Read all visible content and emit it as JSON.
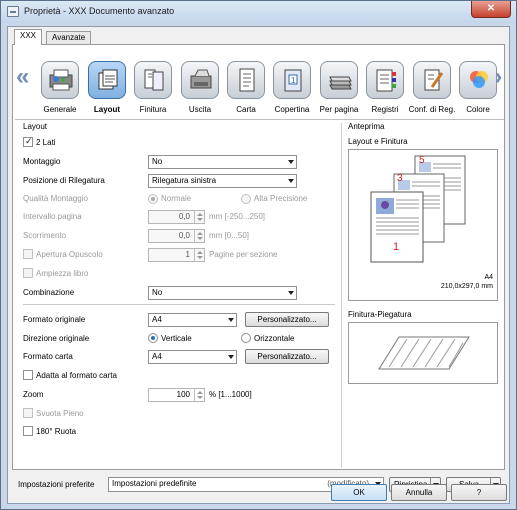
{
  "window": {
    "title": "Proprietà - XXX Documento avanzato"
  },
  "tabs": [
    {
      "label": "XXX"
    },
    {
      "label": "Avanzate"
    }
  ],
  "categories": [
    {
      "label": "Generale",
      "icon": "general-icon"
    },
    {
      "label": "Layout",
      "icon": "layout-icon"
    },
    {
      "label": "Finitura",
      "icon": "finishing-icon"
    },
    {
      "label": "Uscita",
      "icon": "output-icon"
    },
    {
      "label": "Carta",
      "icon": "paper-icon"
    },
    {
      "label": "Copertina",
      "icon": "cover-icon"
    },
    {
      "label": "Per pagina",
      "icon": "per-page-icon"
    },
    {
      "label": "Registri",
      "icon": "tabs-icon"
    },
    {
      "label": "Conf. di Reg.",
      "icon": "config-icon"
    },
    {
      "label": "Colore",
      "icon": "color-icon"
    }
  ],
  "layout": {
    "section_title": "Layout",
    "duplex_label": "2 Lati",
    "montaggio_label": "Montaggio",
    "montaggio_value": "No",
    "posizione_label": "Posizione di Rilegatura",
    "posizione_value": "Rilegatura sinistra",
    "qualita_label": "Qualità Montaggio",
    "qualita_normale": "Normale",
    "qualita_alta": "Alta Precisione",
    "intervallo_label": "Intervallo pagina",
    "intervallo_value": "0,0",
    "intervallo_range": "mm [-250...250]",
    "scorrimento_label": "Scorrimento",
    "scorrimento_value": "0,0",
    "scorrimento_range": "mm [0...50]",
    "apertura_label": "Apertura Opuscolo",
    "apertura_value": "1",
    "apertura_unit": "Pagine per sezione",
    "ampiezza_label": "Ampiezza libro",
    "combinazione_label": "Combinazione",
    "combinazione_value": "No",
    "formato_originale_label": "Formato originale",
    "formato_originale_value": "A4",
    "personalizzato_label": "Personalizzato...",
    "direzione_label": "Direzione originale",
    "verticale_label": "Verticale",
    "orizzontale_label": "Orizzontale",
    "formato_carta_label": "Formato carta",
    "formato_carta_value": "A4",
    "adatta_label": "Adatta al formato carta",
    "zoom_label": "Zoom",
    "zoom_value": "100",
    "zoom_range": "% [1...1000]",
    "svuota_label": "Svuota Pieno",
    "ruota_label": "180° Ruota"
  },
  "preview": {
    "title": "Anteprima",
    "subtitle": "Layout e Finitura",
    "paper": "A4",
    "dims": "210,0x297,0 mm",
    "pages": [
      "1",
      "3",
      "5"
    ],
    "finishing_title": "Finitura-Piegatura"
  },
  "footer": {
    "preset_label": "Impostazioni preferite",
    "preset_value": "Impostazioni predefinite",
    "modified": "(modificato)",
    "reset_label": "Ripristina",
    "save_label": "Salva"
  },
  "dialog": {
    "ok_label": "OK",
    "cancel_label": "Annulla",
    "help_label": "?"
  },
  "colors": {
    "accent": "#3c6ea6",
    "title_bar": "#c4d6ec",
    "page_number": "#cc2222"
  }
}
